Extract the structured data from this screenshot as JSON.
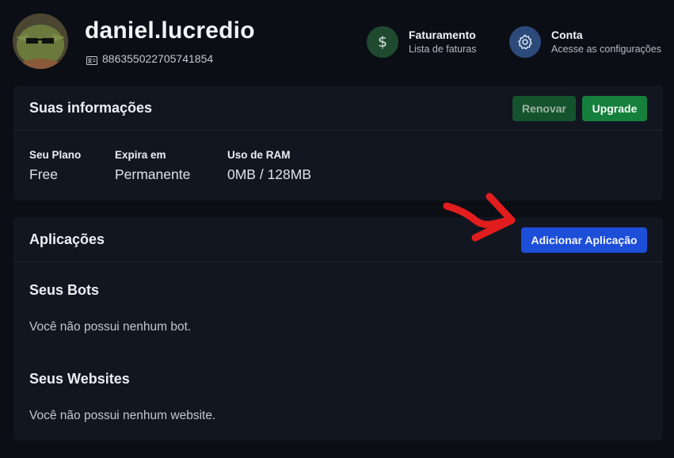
{
  "user": {
    "name": "daniel.lucredio",
    "id": "886355022705741854"
  },
  "header_links": [
    {
      "title": "Faturamento",
      "subtitle": "Lista de faturas",
      "icon": "dollar-icon",
      "color": "#1f4a30"
    },
    {
      "title": "Conta",
      "subtitle": "Acesse as configurações",
      "icon": "gear-icon",
      "color": "#2c4a7a"
    }
  ],
  "info_card": {
    "title": "Suas informações",
    "renew_label": "Renovar",
    "upgrade_label": "Upgrade",
    "fields": [
      {
        "label": "Seu Plano",
        "value": "Free"
      },
      {
        "label": "Expira em",
        "value": "Permanente"
      },
      {
        "label": "Uso de RAM",
        "value": "0MB / 128MB"
      }
    ]
  },
  "apps_card": {
    "title": "Aplicações",
    "add_label": "Adicionar Aplicação",
    "bots_title": "Seus Bots",
    "bots_empty": "Você não possui nenhum bot.",
    "websites_title": "Seus Websites",
    "websites_empty": "Você não possui nenhum website."
  },
  "colors": {
    "background": "#0b0e14",
    "card": "#121621",
    "renew": "#14532d",
    "upgrade": "#15803d",
    "add": "#1d4ed8",
    "annotation": "#e11d1d"
  },
  "annotation": "red-arrow-icon"
}
